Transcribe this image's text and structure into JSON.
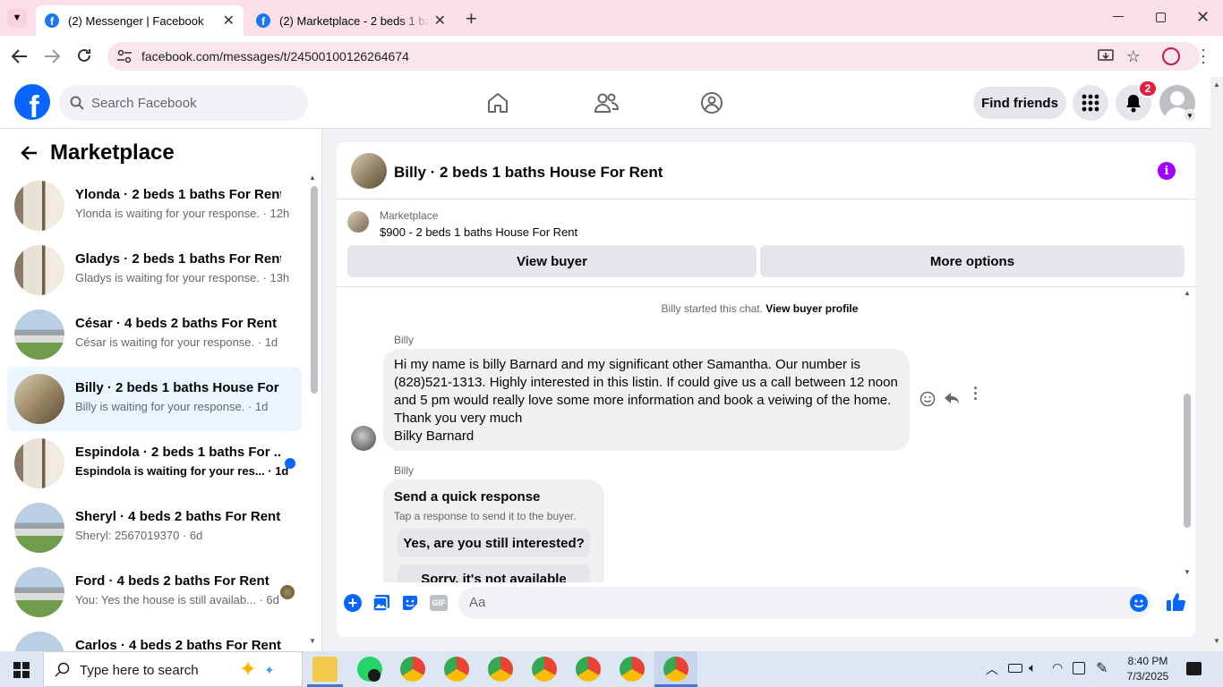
{
  "browser": {
    "tabs": [
      {
        "title": "(2) Messenger | Facebook",
        "active": true
      },
      {
        "title": "(2) Marketplace - 2 beds 1 baths",
        "active": false
      }
    ],
    "url": "facebook.com/messages/t/24500100126264674",
    "accent": "#fbe0e9"
  },
  "fb": {
    "logo": "f",
    "search_placeholder": "Search Facebook",
    "find_friends": "Find friends",
    "notif_count": "2",
    "brand_color": "#0866ff"
  },
  "sidebar": {
    "title": "Marketplace",
    "conversations": [
      {
        "name": "Ylonda · 2 beds 1 baths For Rent",
        "sub": "Ylonda is waiting for your response. · 12h",
        "thumb": "interior",
        "unread": false,
        "active": false
      },
      {
        "name": "Gladys · 2 beds 1 baths For Rent",
        "sub": "Gladys is waiting for your response. · 13h",
        "thumb": "interior",
        "unread": false,
        "active": false
      },
      {
        "name": "César · 4 beds 2 baths For Rent",
        "sub": "César is waiting for your response. · 1d",
        "thumb": "house",
        "unread": false,
        "active": false
      },
      {
        "name": "Billy · 2 beds 1 baths House For ...",
        "sub": "Billy is waiting for your response. · 1d",
        "thumb": "room",
        "unread": false,
        "active": true
      },
      {
        "name": "Espindola · 2 beds 1 baths For ...",
        "sub": "Espindola is waiting for your res... · 1d",
        "thumb": "interior",
        "unread": true,
        "active": false
      },
      {
        "name": "Sheryl · 4 beds 2 baths For Rent",
        "sub": "Sheryl: 2567019370 · 6d",
        "thumb": "house",
        "unread": false,
        "active": false
      },
      {
        "name": "Ford · 4 beds 2 baths For Rent",
        "sub": "You: Yes the house is still availab... · 6d",
        "thumb": "house",
        "unread": false,
        "active": false
      },
      {
        "name": "Carlos · 4 beds 2 baths For Rent",
        "sub": "",
        "thumb": "house",
        "unread": false,
        "active": false
      }
    ]
  },
  "chat": {
    "header_title": "Billy · 2 beds 1 baths House For Rent",
    "listing_label": "Marketplace",
    "listing_title": "$900 - 2 beds 1 baths House For Rent",
    "view_buyer": "View buyer",
    "more_options": "More options",
    "started_text": "Billy started this chat.",
    "view_buyer_profile": "View buyer profile",
    "sender_name": "Billy",
    "message_lines": [
      "Hi my name is billy Barnard and my significant other Samantha. Our number is",
      "(828)521-1313. Highly interested in this listin. If could give us a call between 12 noon",
      "and 5 pm would really love some more information and book a veiwing of the home.",
      "Thank you very much",
      "Bilky Barnard"
    ],
    "quick_response_title": "Send a quick response",
    "quick_response_sub": "Tap a response to send it to the buyer.",
    "quick_replies": [
      "Yes, are you still interested?",
      "Sorry, it's not available"
    ],
    "composer_placeholder": "Aa",
    "gif_label": "GIF",
    "info_color": "#a100ff"
  },
  "taskbar": {
    "search_placeholder": "Type here to search",
    "time": "8:40 PM",
    "date": "7/3/2025"
  }
}
